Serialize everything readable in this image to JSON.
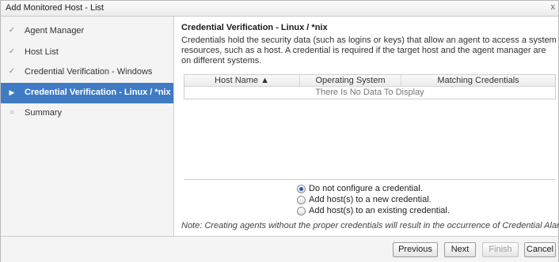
{
  "window": {
    "title": "Add Monitored Host - List",
    "close_glyph": "x"
  },
  "sidebar": {
    "items": [
      {
        "label": "Agent Manager",
        "marker": "✓",
        "state": "done"
      },
      {
        "label": "Host List",
        "marker": "✓",
        "state": "done"
      },
      {
        "label": "Credential Verification - Windows",
        "marker": "✓",
        "state": "done"
      },
      {
        "label": "Credential Verification - Linux / *nix",
        "marker": "▶",
        "state": "active"
      },
      {
        "label": "Summary",
        "marker": "○",
        "state": "pending"
      }
    ]
  },
  "main": {
    "heading": "Credential Verification - Linux / *nix",
    "description": "Credentials hold the security data (such as logins or keys) that allow an agent to access a system resources, such as a host. A credential is required if the target host and the agent manager are on different systems.",
    "table": {
      "columns": [
        "Host Name ▲",
        "Operating System",
        "Matching Credentials"
      ],
      "empty_text": "There Is No Data To Display"
    },
    "options": [
      {
        "label": "Do not configure a credential.",
        "selected": true
      },
      {
        "label": "Add host(s) to a new credential.",
        "selected": false
      },
      {
        "label": "Add host(s) to an existing credential.",
        "selected": false
      }
    ],
    "note": "Note: Creating agents without the proper credentials will result in the occurrence of Credential Alarms."
  },
  "footer": {
    "previous_label": "Previous",
    "next_label": "Next",
    "finish_label": "Finish",
    "cancel_label": "Cancel"
  },
  "colors": {
    "active_step": "#3f7bc4",
    "radio_selected": "#2a5fa8"
  }
}
